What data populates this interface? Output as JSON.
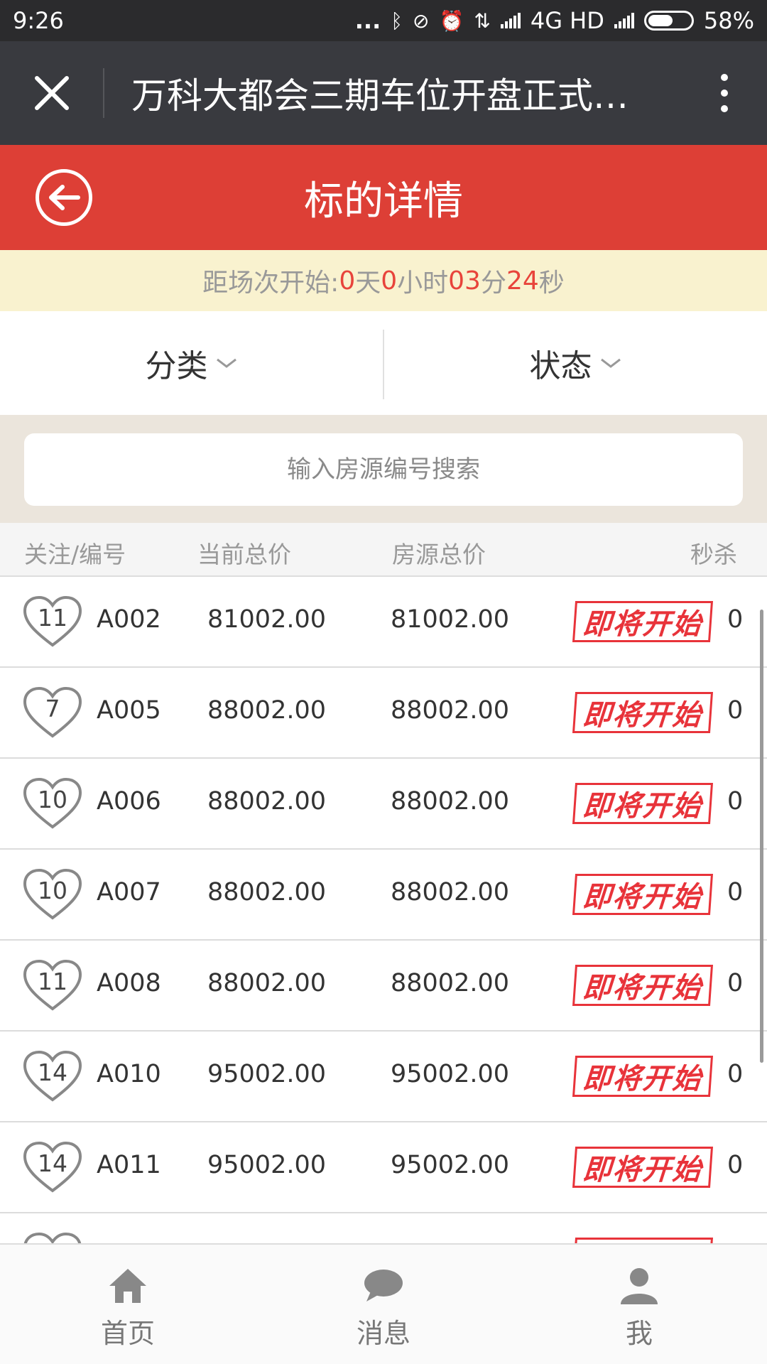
{
  "status_bar": {
    "time": "9:26",
    "dots": "...",
    "network": "4G HD",
    "battery": "58%"
  },
  "wechat": {
    "title": "万科大都会三期车位开盘正式…",
    "close_icon": "close-icon",
    "more_icon": "more-vertical-icon"
  },
  "header": {
    "title": "标的详情",
    "back_icon": "back-circle-icon"
  },
  "countdown": {
    "label": "距场次开始: ",
    "days": "0",
    "days_unit": "天",
    "hours": "0",
    "hours_unit": "小时",
    "minutes": "03",
    "minutes_unit": "分",
    "seconds": "24",
    "seconds_unit": "秒"
  },
  "filters": {
    "category": "分类",
    "status": "状态"
  },
  "search": {
    "placeholder": "输入房源编号搜索",
    "value": ""
  },
  "table": {
    "headers": {
      "follow": "关注/编号",
      "current": "当前总价",
      "total": "房源总价",
      "flash": "秒杀"
    },
    "badge_label": "即将开始",
    "rows": [
      {
        "likes": "11",
        "code": "A002",
        "current": "81002.00",
        "total": "81002.00",
        "count": "0"
      },
      {
        "likes": "7",
        "code": "A005",
        "current": "88002.00",
        "total": "88002.00",
        "count": "0"
      },
      {
        "likes": "10",
        "code": "A006",
        "current": "88002.00",
        "total": "88002.00",
        "count": "0"
      },
      {
        "likes": "10",
        "code": "A007",
        "current": "88002.00",
        "total": "88002.00",
        "count": "0"
      },
      {
        "likes": "11",
        "code": "A008",
        "current": "88002.00",
        "total": "88002.00",
        "count": "0"
      },
      {
        "likes": "14",
        "code": "A010",
        "current": "95002.00",
        "total": "95002.00",
        "count": "0"
      },
      {
        "likes": "14",
        "code": "A011",
        "current": "95002.00",
        "total": "95002.00",
        "count": "0"
      },
      {
        "likes": "",
        "code": "",
        "current": "",
        "total": "",
        "count": ""
      }
    ]
  },
  "tabs": [
    {
      "label": "首页",
      "icon": "home-icon"
    },
    {
      "label": "消息",
      "icon": "message-icon"
    },
    {
      "label": "我",
      "icon": "user-icon"
    }
  ],
  "colors": {
    "accent": "#dd3f36",
    "countdown_bg": "#f9f2cf",
    "wechat_bar": "#393a3f"
  }
}
